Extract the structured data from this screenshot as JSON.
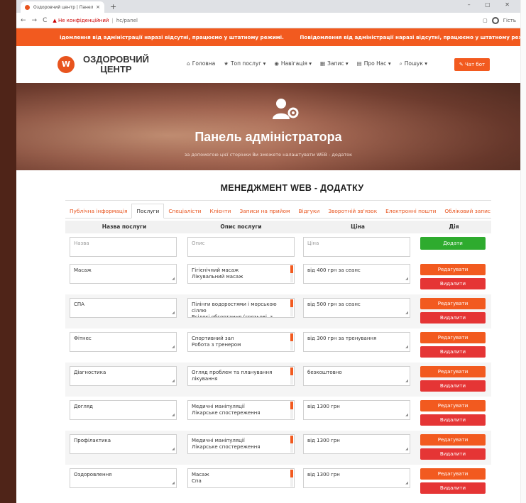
{
  "browser": {
    "tab_title": "Оздоровчий центр | Панель упр",
    "tab_close": "×",
    "new_tab": "+",
    "window_controls": "–  ▢  ✕",
    "url_warning": "▲ Не конфіденційний",
    "url_path": "hc/panel",
    "profile_label": "Гість"
  },
  "notice": {
    "messages": [
      "ідомлення від адміністрації наразі відсутні, працюємо у штатному режимі.",
      "Повідомлення від адміністрації наразі відсутні, працюємо у штатному режимі."
    ]
  },
  "header": {
    "logo_letter": "W",
    "brand_line1": "ОЗДОРОВЧИЙ",
    "brand_line2": "ЦЕНТР",
    "menu": [
      {
        "icon": "home-icon",
        "glyph": "⌂",
        "label": "Головна"
      },
      {
        "icon": "star-icon",
        "glyph": "★",
        "label": "Топ послуг ▾"
      },
      {
        "icon": "compass-icon",
        "glyph": "◉",
        "label": "Навігація ▾"
      },
      {
        "icon": "calendar-icon",
        "glyph": "▦",
        "label": "Запис ▾"
      },
      {
        "icon": "list-icon",
        "glyph": "▤",
        "label": "Про Нас ▾"
      },
      {
        "icon": "search-icon",
        "glyph": "⌕",
        "label": "Пошук ▾"
      }
    ],
    "chat_button": "✎ Чат бот"
  },
  "hero": {
    "title": "Панель адміністратора",
    "subtitle": "за допомогою цієї сторінки Ви зможете налаштувати WEB - додаток"
  },
  "section_title": "МЕНЕДЖМЕНТ WEB - ДОДАТКУ",
  "tabs": [
    {
      "label": "Публічна інформація",
      "active": false
    },
    {
      "label": "Послуги",
      "active": true
    },
    {
      "label": "Спеціалісти",
      "active": false
    },
    {
      "label": "Клієнти",
      "active": false
    },
    {
      "label": "Записи на прийом",
      "active": false
    },
    {
      "label": "Відгуки",
      "active": false
    },
    {
      "label": "Зворотній зв'язок",
      "active": false
    },
    {
      "label": "Електронні пошти",
      "active": false
    },
    {
      "label": "Обліковий запис",
      "active": false
    }
  ],
  "table": {
    "headers": [
      "Назва послуги",
      "Опис послуги",
      "Ціна",
      "Дія"
    ],
    "new_row": {
      "name_placeholder": "Назва",
      "desc_placeholder": "Опис",
      "price_placeholder": "Ціна",
      "add_button": "Додати"
    },
    "edit_button": "Редагувати",
    "delete_button": "Видалити",
    "rows": [
      {
        "name": "Масаж",
        "desc": "Гігієнічний масаж\nЛікувальний масаж",
        "price": "від 400 грн за сеанс"
      },
      {
        "name": "СПА",
        "desc": "Пілінги водоростями і морською сіллю\nВсілякі обгортання (грязьові, з",
        "price": "від 500 грн за сеанс"
      },
      {
        "name": "Фітнес",
        "desc": "Спортивний зал\nРобота з тренером",
        "price": "від 300 грн за тренування"
      },
      {
        "name": "Діагностика",
        "desc": "Огляд проблем та планування\nлікування",
        "price": "безкоштовно"
      },
      {
        "name": "Догляд",
        "desc": "Медичні маніпуляції\nЛікарське спостереження",
        "price": "від 1300 грн"
      },
      {
        "name": "Профілактика",
        "desc": "Медичні маніпуляції\nЛікарське спостереження",
        "price": "від 1300 грн"
      },
      {
        "name": "Оздоровлення",
        "desc": "Масаж\nСпа",
        "price": "від 1300 грн"
      }
    ]
  },
  "colors": {
    "accent": "#f25a1f",
    "add_green": "#2eab2e",
    "delete_red": "#e53535"
  }
}
